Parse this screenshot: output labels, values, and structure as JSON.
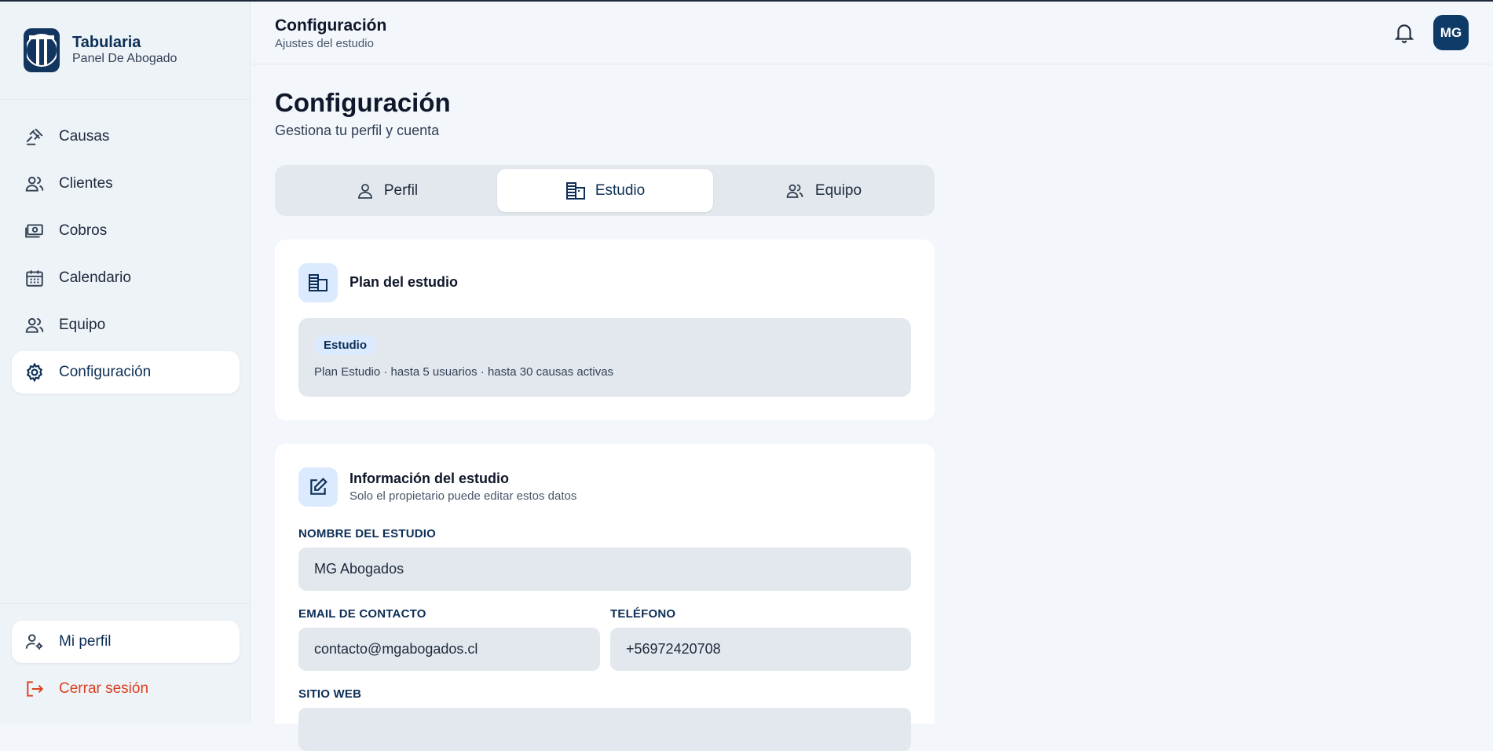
{
  "brand": {
    "name": "Tabularia",
    "subtitle": "Panel De Abogado"
  },
  "sidebar": {
    "items": [
      {
        "label": "Causas",
        "icon": "gavel-icon"
      },
      {
        "label": "Clientes",
        "icon": "users-icon"
      },
      {
        "label": "Cobros",
        "icon": "money-icon"
      },
      {
        "label": "Calendario",
        "icon": "calendar-icon"
      },
      {
        "label": "Equipo",
        "icon": "team-icon"
      },
      {
        "label": "Configuración",
        "icon": "gear-icon",
        "active": true
      }
    ],
    "profile": {
      "label": "Mi perfil",
      "icon": "user-settings-icon"
    },
    "logout": {
      "label": "Cerrar sesión",
      "icon": "logout-icon"
    }
  },
  "header": {
    "title": "Configuración",
    "subtitle": "Ajustes del estudio",
    "avatar": "MG"
  },
  "main": {
    "title": "Configuración",
    "subtitle": "Gestiona tu perfil y cuenta",
    "tabs": [
      {
        "label": "Perfil",
        "icon": "person-icon"
      },
      {
        "label": "Estudio",
        "icon": "building-icon",
        "active": true
      },
      {
        "label": "Equipo",
        "icon": "team-icon"
      }
    ]
  },
  "plan_card": {
    "title": "Plan del estudio",
    "badge": "Estudio",
    "description": "Plan Estudio · hasta 5 usuarios · hasta 30 causas activas"
  },
  "info_card": {
    "title": "Información del estudio",
    "subtitle": "Solo el propietario puede editar estos datos",
    "fields": {
      "name_label": "NOMBRE DEL ESTUDIO",
      "name_value": "MG Abogados",
      "email_label": "EMAIL DE CONTACTO",
      "email_value": "contacto@mgabogados.cl",
      "phone_label": "TELÉFONO",
      "phone_value": "+56972420708",
      "web_label": "SITIO WEB",
      "web_value": ""
    }
  },
  "colors": {
    "brand": "#0d2f56",
    "accent_bg": "#dbeafe",
    "logout": "#d9401f",
    "field_bg": "#e2e8ed"
  }
}
